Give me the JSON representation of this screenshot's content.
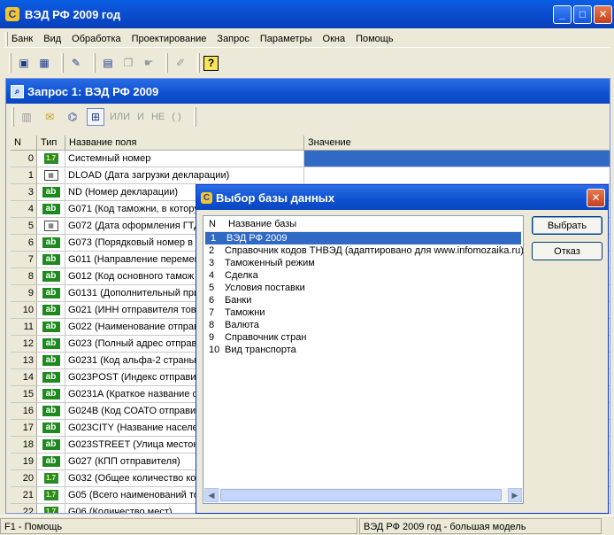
{
  "window": {
    "title": "ВЭД РФ 2009 год"
  },
  "menu": [
    "Банк",
    "Вид",
    "Обработка",
    "Проектирование",
    "Запрос",
    "Параметры",
    "Окна",
    "Помощь"
  ],
  "query_window": {
    "title": "Запрос 1: ВЭД РФ 2009",
    "ops": [
      "ИЛИ",
      "И",
      "НЕ",
      "( )"
    ],
    "columns": [
      "N",
      "Тип",
      "Название поля",
      "Значение"
    ],
    "rows": [
      {
        "n": "0",
        "type": "1.7",
        "name": "Системный номер"
      },
      {
        "n": "1",
        "type": "date",
        "name": "DLOAD (Дата загрузки декларации)"
      },
      {
        "n": "3",
        "type": "ab",
        "name": "ND (Номер декларации)"
      },
      {
        "n": "4",
        "type": "ab",
        "name": "G071 (Код таможни, в которую"
      },
      {
        "n": "5",
        "type": "date",
        "name": "G072 (Дата оформления ГТД)"
      },
      {
        "n": "6",
        "type": "ab",
        "name": "G073 (Порядковый номер в А"
      },
      {
        "n": "7",
        "type": "ab",
        "name": "G011 (Направление перемещ"
      },
      {
        "n": "8",
        "type": "ab",
        "name": "G012 (Код основного тамож"
      },
      {
        "n": "9",
        "type": "ab",
        "name": "G0131 (Дополнительный при"
      },
      {
        "n": "10",
        "type": "ab",
        "name": "G021 (ИНН отправителя това"
      },
      {
        "n": "11",
        "type": "ab",
        "name": "G022 (Наименование отправ"
      },
      {
        "n": "12",
        "type": "ab",
        "name": "G023 (Полный адрес отправи"
      },
      {
        "n": "13",
        "type": "ab",
        "name": "G0231 (Код альфа-2 страны о"
      },
      {
        "n": "14",
        "type": "ab",
        "name": "G023POST (Индекс отправит"
      },
      {
        "n": "15",
        "type": "ab",
        "name": "G0231A (Краткое название с"
      },
      {
        "n": "16",
        "type": "ab",
        "name": "G024B (Код СОАТО отправит"
      },
      {
        "n": "17",
        "type": "ab",
        "name": "G023CITY (Название населе"
      },
      {
        "n": "18",
        "type": "ab",
        "name": "G023STREET (Улица местон"
      },
      {
        "n": "19",
        "type": "ab",
        "name": "G027 (КПП отправителя)"
      },
      {
        "n": "20",
        "type": "1.7",
        "name": "G032 (Общее количество ко"
      },
      {
        "n": "21",
        "type": "1.7",
        "name": "G05 (Всего наименований то"
      },
      {
        "n": "22",
        "type": "1.7",
        "name": "G06 (Количество мест)"
      }
    ]
  },
  "dialog": {
    "title": "Выбор базы данных",
    "columns": [
      "N",
      "Название базы"
    ],
    "items": [
      {
        "n": "1",
        "name": "ВЭД РФ 2009"
      },
      {
        "n": "2",
        "name": "Справочник кодов ТНВЭД (адаптировано для www.infomozaika.ru)"
      },
      {
        "n": "3",
        "name": "Таможенный режим"
      },
      {
        "n": "4",
        "name": "Сделка"
      },
      {
        "n": "5",
        "name": "Условия поставки"
      },
      {
        "n": "6",
        "name": "Банки"
      },
      {
        "n": "7",
        "name": "Таможни"
      },
      {
        "n": "8",
        "name": "Валюта"
      },
      {
        "n": "9",
        "name": "Справочник стран"
      },
      {
        "n": "10",
        "name": "Вид транспорта"
      }
    ],
    "select_button": "Выбрать",
    "cancel_button": "Отказ"
  },
  "status": {
    "help": "F1 - Помощь",
    "model": "ВЭД РФ 2009 год - большая модель"
  }
}
